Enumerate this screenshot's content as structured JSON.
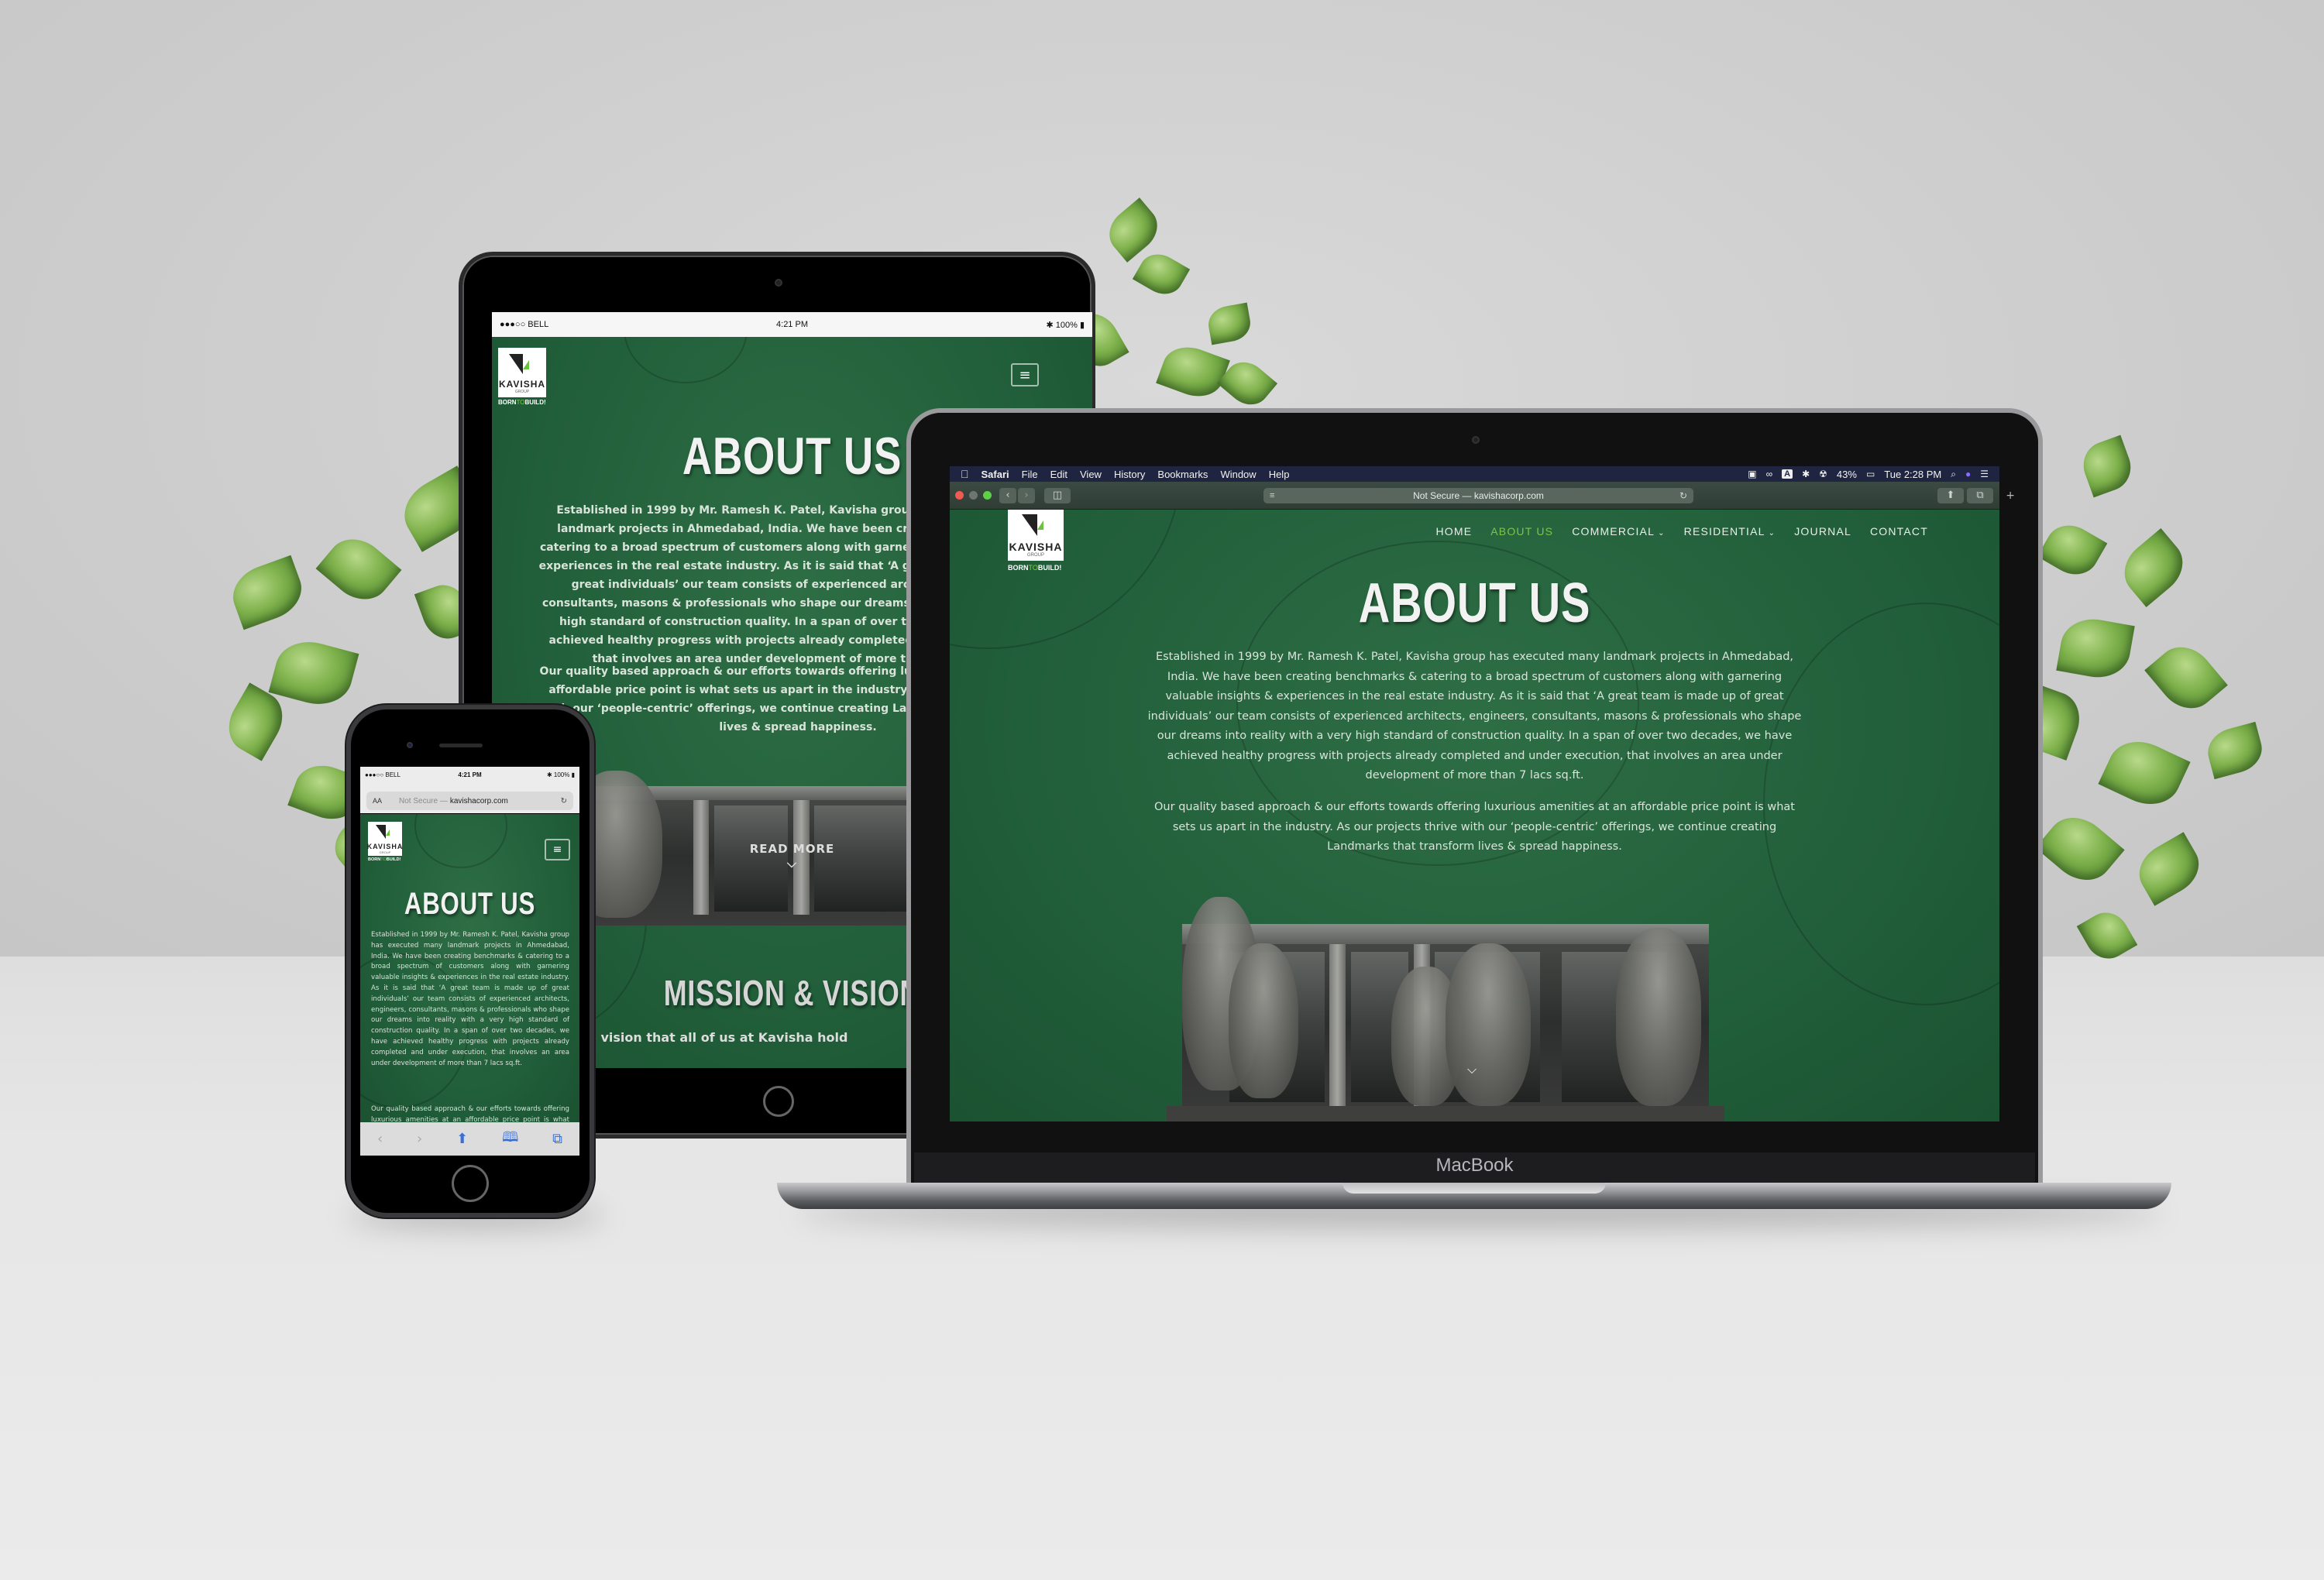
{
  "laptop": {
    "brand_label": "MacBook",
    "menubar": {
      "app": "Safari",
      "items": [
        "File",
        "Edit",
        "View",
        "History",
        "Bookmarks",
        "Window",
        "Help"
      ],
      "battery": "43%",
      "clock": "Tue 2:28 PM"
    },
    "browser": {
      "url_text": "Not Secure — kavishacorp.com"
    }
  },
  "site": {
    "logo": {
      "name": "KAVISHA",
      "group": "GROUP",
      "tagline_born": "BORN",
      "tagline_to": "TO",
      "tagline_build": "BUILD!"
    },
    "nav": [
      {
        "label": "HOME",
        "active": false,
        "dropdown": false
      },
      {
        "label": "ABOUT US",
        "active": true,
        "dropdown": false
      },
      {
        "label": "COMMERCIAL",
        "active": false,
        "dropdown": true
      },
      {
        "label": "RESIDENTIAL",
        "active": false,
        "dropdown": true
      },
      {
        "label": "JOURNAL",
        "active": false,
        "dropdown": false
      },
      {
        "label": "CONTACT",
        "active": false,
        "dropdown": false
      }
    ],
    "about_title": "ABOUT US",
    "about_p1": "Established in 1999 by Mr. Ramesh K. Patel, Kavisha group has executed many landmark projects in Ahmedabad, India. We have been creating benchmarks & catering to a broad spectrum of customers along with garnering valuable insights & experiences in the real estate industry. As it is said that ‘A great team is made up of great individuals’ our team consists of experienced architects, engineers, consultants, masons & professionals who shape our dreams into reality with a very high standard of construction quality. In a span of over two decades, we have achieved healthy progress with projects already completed and under execution, that involves an area under development of more than 7 lacs sq.ft.",
    "about_p2": "Our quality based approach & our efforts towards offering luxurious amenities at an affordable price point is what sets us apart in the industry. As our projects thrive with our ‘people-centric’ offerings, we continue creating Landmarks that transform lives & spread happiness.",
    "read_more": "READ MORE",
    "mission_title": "MISSION & VISION",
    "mission_text": "r Future’ is the vision that all of us at Kavisha hold"
  },
  "tablet": {
    "status": {
      "carrier": "●●●○○ BELL",
      "time": "4:21 PM",
      "battery": "100%"
    }
  },
  "phone": {
    "status": {
      "carrier": "●●●○○ BELL",
      "time": "4:21 PM",
      "battery": "100%"
    },
    "url": {
      "text_size_label": "AA",
      "not_secure": "Not Secure —",
      "domain": "kavishacorp.com"
    }
  },
  "colors": {
    "site_green": "#22603b",
    "accent_green": "#7fc24a",
    "safari_blue": "#3a6fd8"
  }
}
